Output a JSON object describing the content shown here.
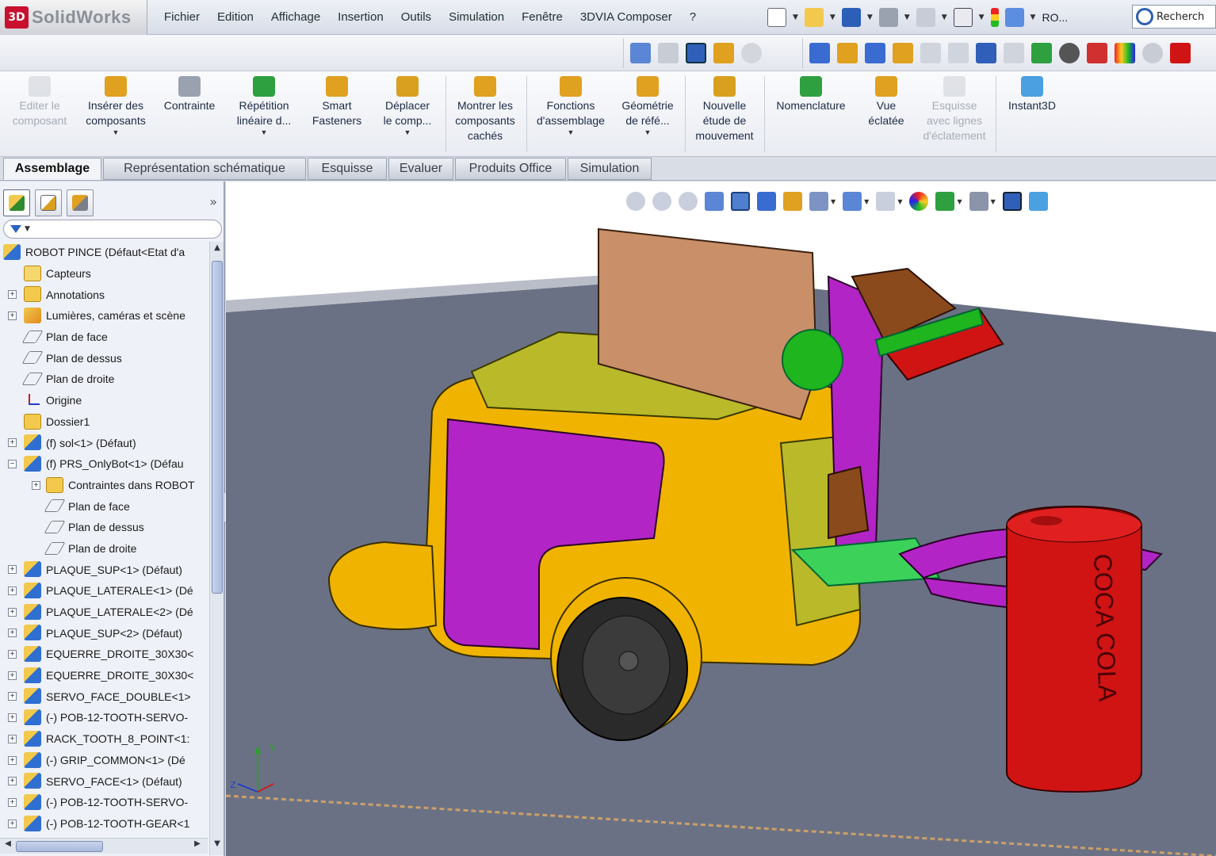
{
  "app": {
    "logo": "SolidWorks",
    "logo_mark": "3D"
  },
  "menu": [
    "Fichier",
    "Edition",
    "Affichage",
    "Insertion",
    "Outils",
    "Simulation",
    "Fenêtre",
    "3DVIA Composer",
    "?"
  ],
  "quick_access": {
    "ro_label": "RO...",
    "search_placeholder": "Recherch"
  },
  "ribbon": {
    "buttons": [
      {
        "label": "Editer le\ncomposant",
        "enabled": false,
        "has_menu": false
      },
      {
        "label": "Insérer des\ncomposants",
        "enabled": true,
        "has_menu": true
      },
      {
        "label": "Contrainte",
        "enabled": true,
        "has_menu": false
      },
      {
        "label": "Répétition\nlinéaire d...",
        "enabled": true,
        "has_menu": true
      },
      {
        "label": "Smart\nFasteners",
        "enabled": true,
        "has_menu": false
      },
      {
        "label": "Déplacer\nle comp...",
        "enabled": true,
        "has_menu": true
      },
      {
        "label": "Montrer les\ncomposants\ncachés",
        "enabled": true,
        "has_menu": false
      },
      {
        "label": "Fonctions\nd'assemblage",
        "enabled": true,
        "has_menu": true
      },
      {
        "label": "Géométrie\nde réfé...",
        "enabled": true,
        "has_menu": true
      },
      {
        "label": "Nouvelle\nétude de\nmouvement",
        "enabled": true,
        "has_menu": false
      },
      {
        "label": "Nomenclature",
        "enabled": true,
        "has_menu": false
      },
      {
        "label": "Vue\néclatée",
        "enabled": true,
        "has_menu": false
      },
      {
        "label": "Esquisse\navec lignes\nd'éclatement",
        "enabled": false,
        "has_menu": false
      },
      {
        "label": "Instant3D",
        "enabled": true,
        "has_menu": false
      }
    ]
  },
  "tabs": [
    {
      "label": "Assemblage",
      "active": true
    },
    {
      "label": "Représentation schématique",
      "active": false
    },
    {
      "label": "Esquisse",
      "active": false
    },
    {
      "label": "Evaluer",
      "active": false
    },
    {
      "label": "Produits Office",
      "active": false
    },
    {
      "label": "Simulation",
      "active": false
    }
  ],
  "feature_tree": {
    "expand_glyph": "»",
    "items": [
      {
        "label": "ROBOT PINCE  (Défaut<Etat d'a",
        "icon": "assembly-icon",
        "depth": 0,
        "expander": ""
      },
      {
        "label": "Capteurs",
        "icon": "sensor-icon",
        "depth": 1,
        "expander": ""
      },
      {
        "label": "Annotations",
        "icon": "annotation-icon",
        "depth": 1,
        "expander": "+"
      },
      {
        "label": "Lumières, caméras et scène",
        "icon": "lights-icon",
        "depth": 1,
        "expander": "+"
      },
      {
        "label": "Plan de face",
        "icon": "plane-icon",
        "depth": 1,
        "expander": ""
      },
      {
        "label": "Plan de dessus",
        "icon": "plane-icon",
        "depth": 1,
        "expander": ""
      },
      {
        "label": "Plan de droite",
        "icon": "plane-icon",
        "depth": 1,
        "expander": ""
      },
      {
        "label": "Origine",
        "icon": "origin-icon",
        "depth": 1,
        "expander": ""
      },
      {
        "label": "Dossier1",
        "icon": "folder-icon",
        "depth": 1,
        "expander": ""
      },
      {
        "label": "(f) sol<1> (Défaut)",
        "icon": "assembly-icon",
        "depth": 1,
        "expander": "+"
      },
      {
        "label": "(f) PRS_OnlyBot<1> (Défau",
        "icon": "assembly-icon",
        "depth": 1,
        "expander": "−"
      },
      {
        "label": "Contraintes dans ROBOT",
        "icon": "folder-icon",
        "depth": 2,
        "expander": "+"
      },
      {
        "label": "Plan de face",
        "icon": "plane-icon",
        "depth": 2,
        "expander": ""
      },
      {
        "label": "Plan de dessus",
        "icon": "plane-icon",
        "depth": 2,
        "expander": ""
      },
      {
        "label": "Plan de droite",
        "icon": "plane-icon",
        "depth": 2,
        "expander": ""
      },
      {
        "label": "PLAQUE_SUP<1> (Défaut)",
        "icon": "assembly-icon",
        "depth": 1,
        "expander": "+"
      },
      {
        "label": "PLAQUE_LATERALE<1> (Dé",
        "icon": "assembly-icon",
        "depth": 1,
        "expander": "+"
      },
      {
        "label": "PLAQUE_LATERALE<2> (Dé",
        "icon": "assembly-icon",
        "depth": 1,
        "expander": "+"
      },
      {
        "label": "PLAQUE_SUP<2> (Défaut)",
        "icon": "assembly-icon",
        "depth": 1,
        "expander": "+"
      },
      {
        "label": "EQUERRE_DROITE_30X30<",
        "icon": "assembly-icon",
        "depth": 1,
        "expander": "+"
      },
      {
        "label": "EQUERRE_DROITE_30X30<",
        "icon": "assembly-icon",
        "depth": 1,
        "expander": "+"
      },
      {
        "label": "SERVO_FACE_DOUBLE<1>",
        "icon": "assembly-icon",
        "depth": 1,
        "expander": "+"
      },
      {
        "label": "(-) POB-12-TOOTH-SERVO-",
        "icon": "assembly-icon",
        "depth": 1,
        "expander": "+"
      },
      {
        "label": "RACK_TOOTH_8_POINT<1:",
        "icon": "assembly-icon",
        "depth": 1,
        "expander": "+"
      },
      {
        "label": "(-) GRIP_COMMON<1> (Dé",
        "icon": "assembly-icon",
        "depth": 1,
        "expander": "+"
      },
      {
        "label": "SERVO_FACE<1> (Défaut)",
        "icon": "assembly-icon",
        "depth": 1,
        "expander": "+"
      },
      {
        "label": "(-) POB-12-TOOTH-SERVO-",
        "icon": "assembly-icon",
        "depth": 1,
        "expander": "+"
      },
      {
        "label": "(-) POB-12-TOOTH-GEAR<1",
        "icon": "assembly-icon",
        "depth": 1,
        "expander": "+"
      }
    ]
  },
  "viewport": {
    "can_label": "COCA COLA",
    "colors": {
      "floor": "#6b7184",
      "body": "#f0b400",
      "magenta": "#b324c6",
      "green": "#1fb51f",
      "red": "#d01414",
      "brown": "#c98f68"
    }
  }
}
